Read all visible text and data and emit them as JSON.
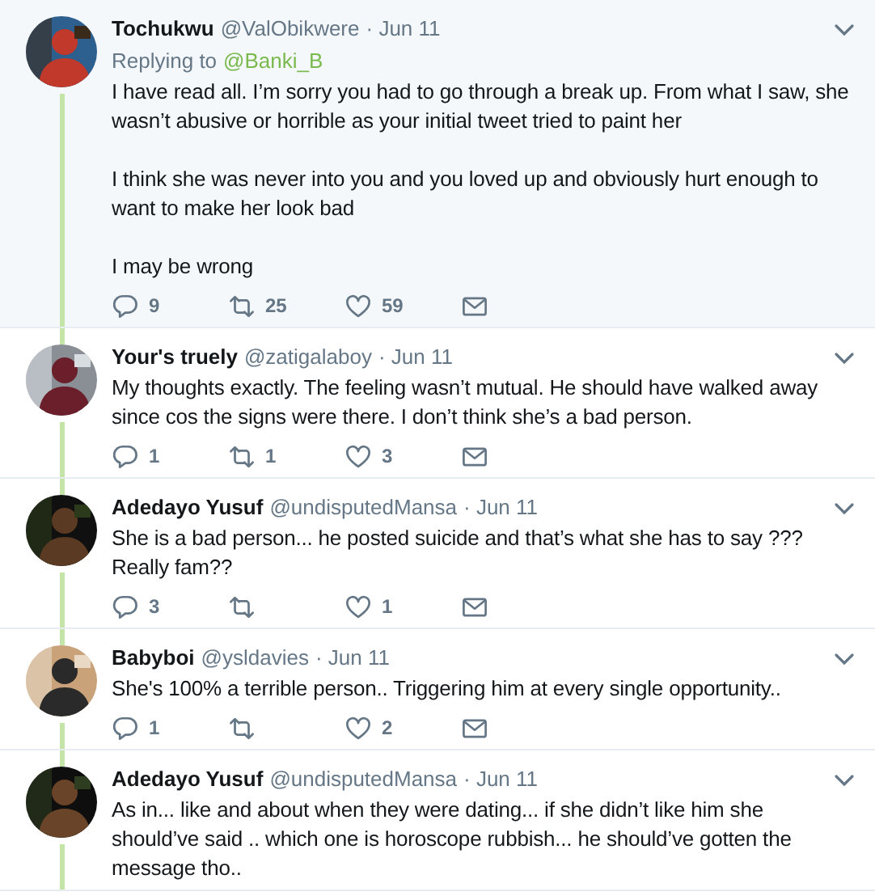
{
  "tweets": [
    {
      "name": "Tochukwu",
      "handle": "@ValObikwere",
      "date": "· Jun 11",
      "replying_label": "Replying to",
      "replying_to": "@Banki_B",
      "paragraphs": [
        "I have read all. I’m sorry you had to go through a break up. From what I saw, she wasn’t abusive or horrible as your initial tweet tried to paint her",
        "I think she was never into you and you loved up and obviously hurt enough to want to make her look bad",
        "I may be wrong"
      ],
      "replies": "9",
      "retweets": "25",
      "likes": "59"
    },
    {
      "name": "Your's truely",
      "handle": "@zatigalaboy",
      "date": "· Jun 11",
      "paragraphs": [
        "My thoughts exactly. The feeling wasn’t mutual. He should have walked away since cos the signs were there. I don’t think she’s a bad person."
      ],
      "replies": "1",
      "retweets": "1",
      "likes": "3"
    },
    {
      "name": "Adedayo Yusuf",
      "handle": "@undisputedMansa",
      "date": "· Jun 11",
      "paragraphs": [
        "She is a bad person... he posted suicide and that’s what she has to say ??? Really fam??"
      ],
      "replies": "3",
      "likes": "1"
    },
    {
      "name": "Babyboi",
      "handle": "@ysldavies",
      "date": "· Jun 11",
      "paragraphs": [
        "She's 100% a terrible person.. Triggering him at every single opportunity.."
      ],
      "replies": "1",
      "likes": "2"
    },
    {
      "name": "Adedayo Yusuf",
      "handle": "@undisputedMansa",
      "date": "· Jun 11",
      "paragraphs": [
        "As in... like and about when they were dating... if she didn’t like him she should’ve said .. which one is horoscope rubbish... he should’ve gotten the message tho.."
      ]
    }
  ]
}
